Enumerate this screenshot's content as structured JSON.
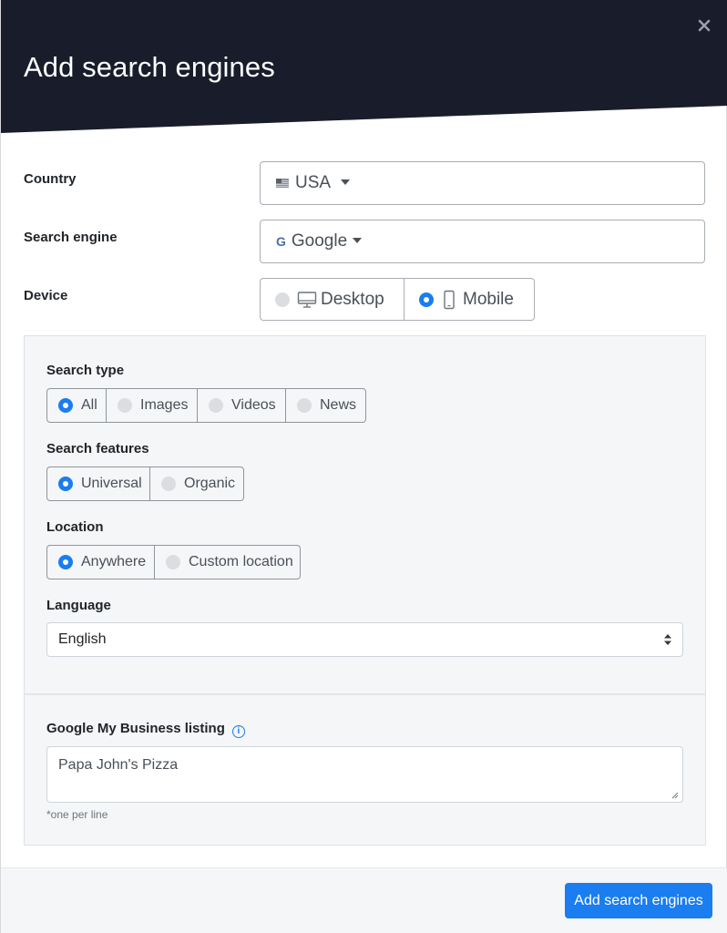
{
  "modal": {
    "title": "Add search engines"
  },
  "country": {
    "label": "Country",
    "value": "USA"
  },
  "search_engine": {
    "label": "Search engine",
    "icon_text": "G",
    "value": "Google"
  },
  "device": {
    "label": "Device",
    "options": [
      {
        "label": "Desktop",
        "icon": "desktop-icon",
        "selected": false
      },
      {
        "label": "Mobile",
        "icon": "mobile-icon",
        "selected": true
      }
    ]
  },
  "search_type": {
    "label": "Search type",
    "options": [
      {
        "label": "All",
        "selected": true
      },
      {
        "label": "Images",
        "selected": false
      },
      {
        "label": "Videos",
        "selected": false
      },
      {
        "label": "News",
        "selected": false
      }
    ]
  },
  "search_features": {
    "label": "Search features",
    "options": [
      {
        "label": "Universal",
        "selected": true
      },
      {
        "label": "Organic",
        "selected": false
      }
    ]
  },
  "location": {
    "label": "Location",
    "options": [
      {
        "label": "Anywhere",
        "selected": true
      },
      {
        "label": "Custom location",
        "selected": false
      }
    ]
  },
  "language": {
    "label": "Language",
    "value": "English"
  },
  "gmb": {
    "label": "Google My Business listing",
    "info_text": "i",
    "value": "Papa John's Pizza",
    "hint": "*one per line"
  },
  "footer": {
    "submit_label": "Add search engines"
  },
  "colors": {
    "header_bg": "#191d2b",
    "accent": "#1a7df0",
    "panel_bg": "#f5f6f8"
  }
}
